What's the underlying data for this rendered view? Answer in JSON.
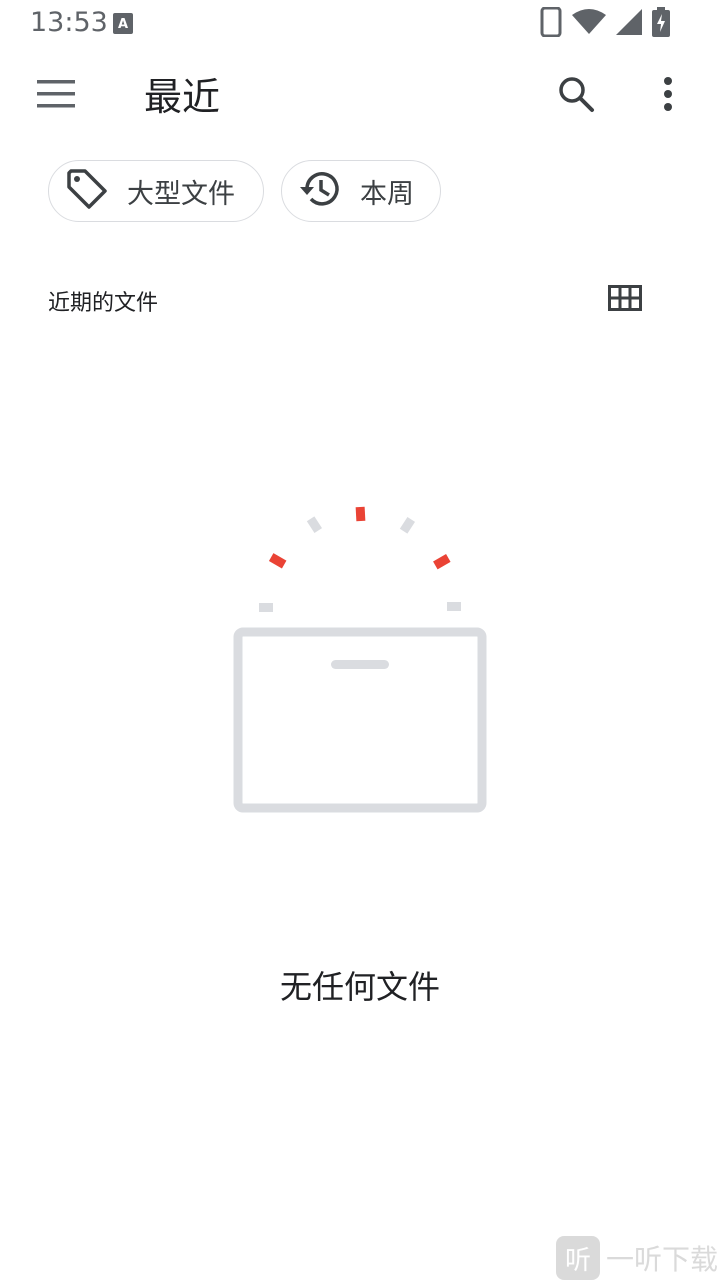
{
  "status_bar": {
    "time": "13:53",
    "notification_icon": "a-square-icon",
    "icons": [
      "phone-icon",
      "wifi-icon",
      "signal-icon",
      "battery-charging-icon"
    ]
  },
  "app_bar": {
    "title": "最近",
    "menu_icon": "hamburger-menu-icon",
    "search_icon": "search-icon",
    "more_icon": "more-vert-icon"
  },
  "filters": [
    {
      "label": "大型文件",
      "icon": "tag-icon"
    },
    {
      "label": "本周",
      "icon": "history-icon"
    }
  ],
  "section": {
    "title": "近期的文件",
    "view_toggle_icon": "grid-view-icon"
  },
  "empty_state": {
    "message": "无任何文件",
    "illustration": "empty-box-illustration"
  },
  "watermark": {
    "badge": "听",
    "text": "一听下载"
  },
  "colors": {
    "accent_red": "#ea4335",
    "illustration_gray": "#dadce0",
    "icon_dark": "#3c4043"
  }
}
